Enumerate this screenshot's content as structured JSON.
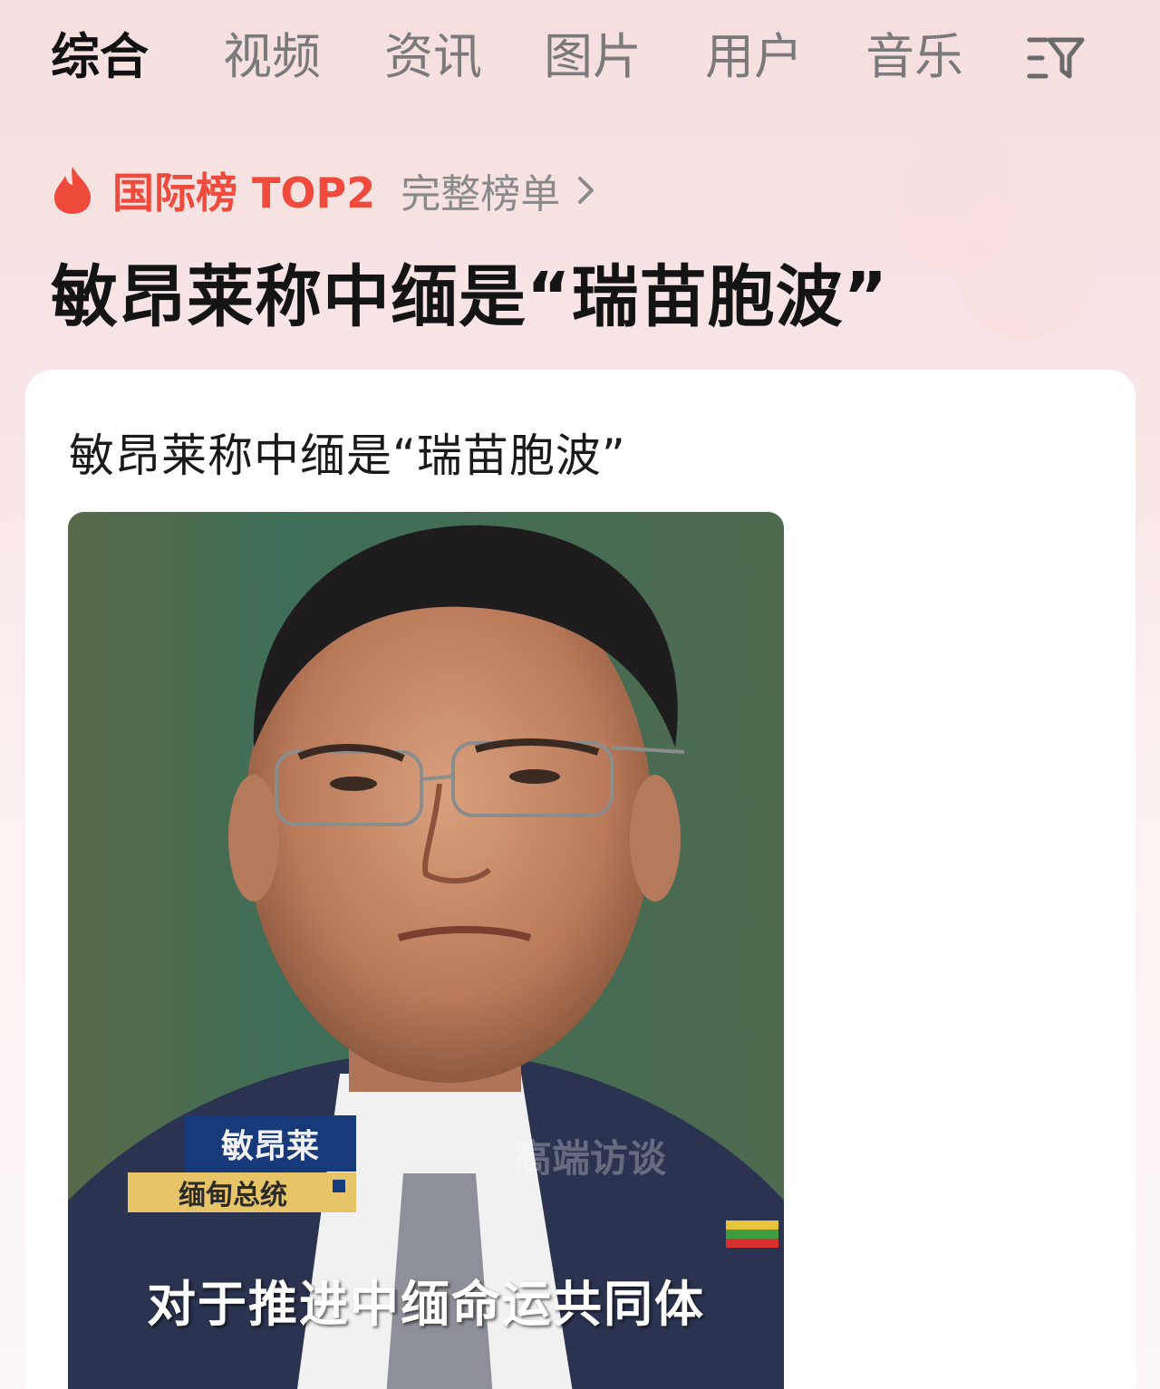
{
  "tabs": [
    {
      "label": "综合",
      "active": true
    },
    {
      "label": "视频",
      "active": false
    },
    {
      "label": "资讯",
      "active": false
    },
    {
      "label": "图片",
      "active": false
    },
    {
      "label": "用户",
      "active": false
    },
    {
      "label": "音乐",
      "active": false
    }
  ],
  "filter_icon": "filter-icon",
  "trending": {
    "rank_label": "国际榜 TOP2",
    "full_list_label": "完整榜单",
    "accent_color": "#f04a3c"
  },
  "headline": "敏昂莱称中缅是“瑞苗胞波”",
  "card": {
    "title": "敏昂莱称中缅是“瑞苗胞波”",
    "image": {
      "lower_third_name": "敏昂莱",
      "lower_third_role": "缅甸总统",
      "watermark": "高端访谈",
      "subtitle": "对于推进中缅命运共同体"
    }
  }
}
